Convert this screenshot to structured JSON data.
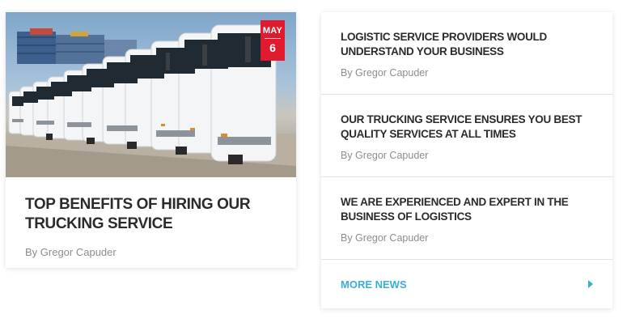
{
  "featured": {
    "date_month": "MAY",
    "date_day": "6",
    "title": "TOP BENEFITS OF HIRING OUR TRUCKING SERVICE",
    "author": "By Gregor Capuder"
  },
  "news": [
    {
      "title": "LOGISTIC SERVICE PROVIDERS WOULD UNDERSTAND YOUR BUSINESS",
      "author": "By Gregor Capuder"
    },
    {
      "title": "OUR TRUCKING SERVICE ENSURES YOU BEST QUALITY SERVICES AT ALL TIMES",
      "author": "By Gregor Capuder"
    },
    {
      "title": "WE ARE EXPERIENCED AND EXPERT IN THE BUSINESS OF LOGISTICS",
      "author": "By Gregor Capuder"
    }
  ],
  "more_news": {
    "label": "MORE NEWS",
    "icon": "arrow-right-icon"
  },
  "colors": {
    "accent_red": "#e11b2f",
    "link_blue": "#3aafd0",
    "title_text": "#2b2b2b",
    "muted_text": "#8d8d8d"
  }
}
